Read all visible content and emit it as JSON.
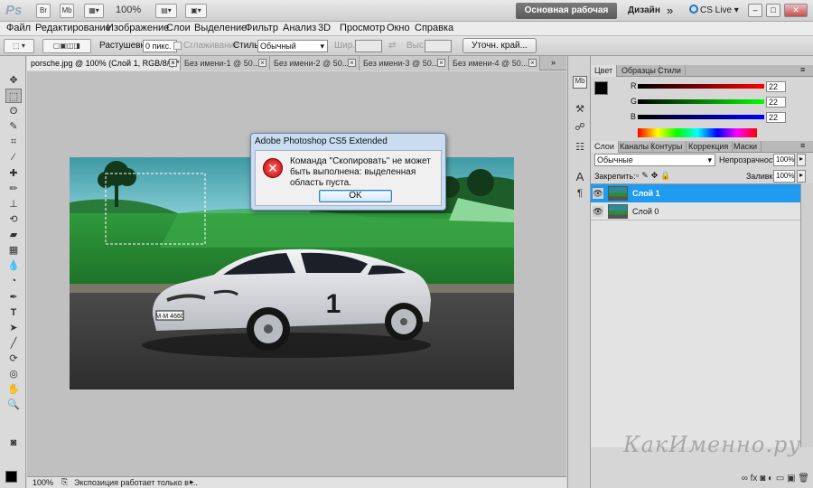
{
  "titlebar": {
    "logo": "Ps",
    "br_label": "Br",
    "mb_label": "Mb",
    "zoom": "100%",
    "workspace": "Основная рабочая среда",
    "design": "Дизайн",
    "more": "»",
    "cslive": "CS Live ▾"
  },
  "menu": [
    "Файл",
    "Редактирование",
    "Изображение",
    "Слои",
    "Выделение",
    "Фильтр",
    "Анализ",
    "3D",
    "Просмотр",
    "Окно",
    "Справка"
  ],
  "options": {
    "feather_label": "Растушевка:",
    "feather_value": "0 пикс.",
    "antialias_label": "Сглаживание",
    "style_label": "Стиль:",
    "style_value": "Обычный",
    "width_label": "Шир.:",
    "height_label": "Выс.:",
    "refine_label": "Уточн. край..."
  },
  "doc_tabs": [
    {
      "label": "porsche.jpg @ 100% (Слой 1, RGB/8#) *"
    },
    {
      "label": "Без имени-1 @ 50..."
    },
    {
      "label": "Без имени-2 @ 50..."
    },
    {
      "label": "Без имени-3 @ 50..."
    },
    {
      "label": "Без имени-4 @ 50..."
    }
  ],
  "status": {
    "zoom": "100%",
    "text": "Экспозиция работает только в ..."
  },
  "color_panel": {
    "tabs": [
      "Цвет",
      "Образцы",
      "Стили"
    ],
    "r_label": "R",
    "g_label": "G",
    "b_label": "B",
    "r_value": "22",
    "g_value": "22",
    "b_value": "22"
  },
  "layers_panel": {
    "tabs": [
      "Слои",
      "Каналы",
      "Контуры",
      "Коррекция",
      "Маски"
    ],
    "blend_mode": "Обычные",
    "opacity_label": "Непрозрачность:",
    "opacity_value": "100%",
    "lock_label": "Закрепить:",
    "fill_label": "Заливка:",
    "fill_value": "100%",
    "layers": [
      {
        "name": "Слой 1",
        "selected": true
      },
      {
        "name": "Слой 0",
        "selected": false
      }
    ],
    "footer_icons": "∞  fx  ◙  ◐  ▭  ▣  🗑"
  },
  "dialog": {
    "title": "Adobe Photoshop CS5 Extended",
    "message": "Команда \"Скопировать\" не может быть выполнена: выделенная область пуста.",
    "ok_label": "OK"
  },
  "photo": {
    "plate": "M·M 4660",
    "door_number": "1"
  },
  "watermark": "КакИменно.ру",
  "colors": {
    "accent_selected_layer": "#1f9bf0",
    "dialog_frame": "#c9dcf0",
    "error_red": "#d40000"
  }
}
